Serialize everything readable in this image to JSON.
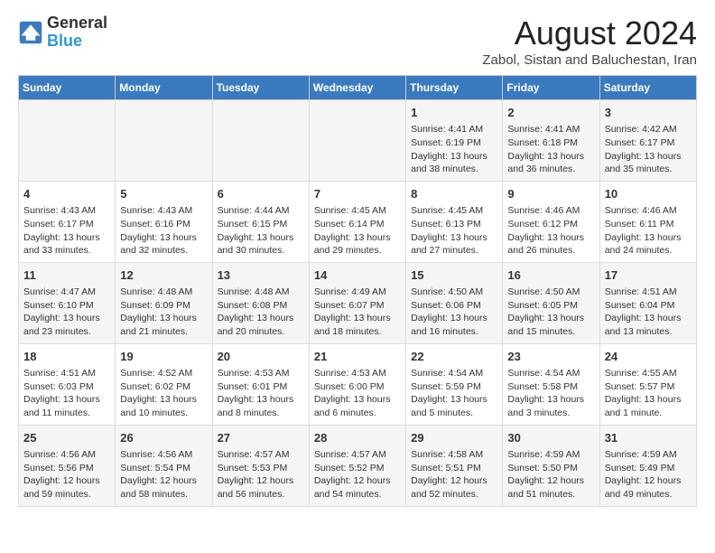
{
  "header": {
    "logo_line1": "General",
    "logo_line2": "Blue",
    "title": "August 2024",
    "subtitle": "Zabol, Sistan and Baluchestan, Iran"
  },
  "weekdays": [
    "Sunday",
    "Monday",
    "Tuesday",
    "Wednesday",
    "Thursday",
    "Friday",
    "Saturday"
  ],
  "weeks": [
    [
      {
        "day": "",
        "info": ""
      },
      {
        "day": "",
        "info": ""
      },
      {
        "day": "",
        "info": ""
      },
      {
        "day": "",
        "info": ""
      },
      {
        "day": "1",
        "info": "Sunrise: 4:41 AM\nSunset: 6:19 PM\nDaylight: 13 hours\nand 38 minutes."
      },
      {
        "day": "2",
        "info": "Sunrise: 4:41 AM\nSunset: 6:18 PM\nDaylight: 13 hours\nand 36 minutes."
      },
      {
        "day": "3",
        "info": "Sunrise: 4:42 AM\nSunset: 6:17 PM\nDaylight: 13 hours\nand 35 minutes."
      }
    ],
    [
      {
        "day": "4",
        "info": "Sunrise: 4:43 AM\nSunset: 6:17 PM\nDaylight: 13 hours\nand 33 minutes."
      },
      {
        "day": "5",
        "info": "Sunrise: 4:43 AM\nSunset: 6:16 PM\nDaylight: 13 hours\nand 32 minutes."
      },
      {
        "day": "6",
        "info": "Sunrise: 4:44 AM\nSunset: 6:15 PM\nDaylight: 13 hours\nand 30 minutes."
      },
      {
        "day": "7",
        "info": "Sunrise: 4:45 AM\nSunset: 6:14 PM\nDaylight: 13 hours\nand 29 minutes."
      },
      {
        "day": "8",
        "info": "Sunrise: 4:45 AM\nSunset: 6:13 PM\nDaylight: 13 hours\nand 27 minutes."
      },
      {
        "day": "9",
        "info": "Sunrise: 4:46 AM\nSunset: 6:12 PM\nDaylight: 13 hours\nand 26 minutes."
      },
      {
        "day": "10",
        "info": "Sunrise: 4:46 AM\nSunset: 6:11 PM\nDaylight: 13 hours\nand 24 minutes."
      }
    ],
    [
      {
        "day": "11",
        "info": "Sunrise: 4:47 AM\nSunset: 6:10 PM\nDaylight: 13 hours\nand 23 minutes."
      },
      {
        "day": "12",
        "info": "Sunrise: 4:48 AM\nSunset: 6:09 PM\nDaylight: 13 hours\nand 21 minutes."
      },
      {
        "day": "13",
        "info": "Sunrise: 4:48 AM\nSunset: 6:08 PM\nDaylight: 13 hours\nand 20 minutes."
      },
      {
        "day": "14",
        "info": "Sunrise: 4:49 AM\nSunset: 6:07 PM\nDaylight: 13 hours\nand 18 minutes."
      },
      {
        "day": "15",
        "info": "Sunrise: 4:50 AM\nSunset: 6:06 PM\nDaylight: 13 hours\nand 16 minutes."
      },
      {
        "day": "16",
        "info": "Sunrise: 4:50 AM\nSunset: 6:05 PM\nDaylight: 13 hours\nand 15 minutes."
      },
      {
        "day": "17",
        "info": "Sunrise: 4:51 AM\nSunset: 6:04 PM\nDaylight: 13 hours\nand 13 minutes."
      }
    ],
    [
      {
        "day": "18",
        "info": "Sunrise: 4:51 AM\nSunset: 6:03 PM\nDaylight: 13 hours\nand 11 minutes."
      },
      {
        "day": "19",
        "info": "Sunrise: 4:52 AM\nSunset: 6:02 PM\nDaylight: 13 hours\nand 10 minutes."
      },
      {
        "day": "20",
        "info": "Sunrise: 4:53 AM\nSunset: 6:01 PM\nDaylight: 13 hours\nand 8 minutes."
      },
      {
        "day": "21",
        "info": "Sunrise: 4:53 AM\nSunset: 6:00 PM\nDaylight: 13 hours\nand 6 minutes."
      },
      {
        "day": "22",
        "info": "Sunrise: 4:54 AM\nSunset: 5:59 PM\nDaylight: 13 hours\nand 5 minutes."
      },
      {
        "day": "23",
        "info": "Sunrise: 4:54 AM\nSunset: 5:58 PM\nDaylight: 13 hours\nand 3 minutes."
      },
      {
        "day": "24",
        "info": "Sunrise: 4:55 AM\nSunset: 5:57 PM\nDaylight: 13 hours\nand 1 minute."
      }
    ],
    [
      {
        "day": "25",
        "info": "Sunrise: 4:56 AM\nSunset: 5:56 PM\nDaylight: 12 hours\nand 59 minutes."
      },
      {
        "day": "26",
        "info": "Sunrise: 4:56 AM\nSunset: 5:54 PM\nDaylight: 12 hours\nand 58 minutes."
      },
      {
        "day": "27",
        "info": "Sunrise: 4:57 AM\nSunset: 5:53 PM\nDaylight: 12 hours\nand 56 minutes."
      },
      {
        "day": "28",
        "info": "Sunrise: 4:57 AM\nSunset: 5:52 PM\nDaylight: 12 hours\nand 54 minutes."
      },
      {
        "day": "29",
        "info": "Sunrise: 4:58 AM\nSunset: 5:51 PM\nDaylight: 12 hours\nand 52 minutes."
      },
      {
        "day": "30",
        "info": "Sunrise: 4:59 AM\nSunset: 5:50 PM\nDaylight: 12 hours\nand 51 minutes."
      },
      {
        "day": "31",
        "info": "Sunrise: 4:59 AM\nSunset: 5:49 PM\nDaylight: 12 hours\nand 49 minutes."
      }
    ]
  ]
}
